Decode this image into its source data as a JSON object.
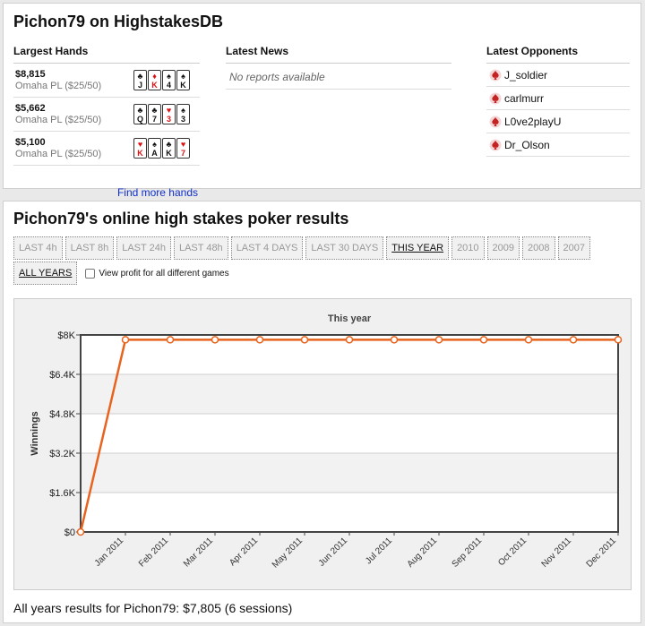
{
  "top": {
    "title": "Pichon79 on HighstakesDB",
    "largest_hands": {
      "heading": "Largest Hands",
      "hands": [
        {
          "amount": "$8,815",
          "game": "Omaha PL ($25/50)",
          "cards": [
            {
              "rank": "J",
              "suit": "♣",
              "color": "black"
            },
            {
              "rank": "K",
              "suit": "♦",
              "color": "red"
            },
            {
              "rank": "4",
              "suit": "♠",
              "color": "black"
            },
            {
              "rank": "K",
              "suit": "♠",
              "color": "black"
            }
          ]
        },
        {
          "amount": "$5,662",
          "game": "Omaha PL ($25/50)",
          "cards": [
            {
              "rank": "Q",
              "suit": "♣",
              "color": "black"
            },
            {
              "rank": "7",
              "suit": "♣",
              "color": "black"
            },
            {
              "rank": "3",
              "suit": "♥",
              "color": "red"
            },
            {
              "rank": "3",
              "suit": "♠",
              "color": "black"
            }
          ]
        },
        {
          "amount": "$5,100",
          "game": "Omaha PL ($25/50)",
          "cards": [
            {
              "rank": "K",
              "suit": "♥",
              "color": "red"
            },
            {
              "rank": "A",
              "suit": "♠",
              "color": "black"
            },
            {
              "rank": "K",
              "suit": "♣",
              "color": "black"
            },
            {
              "rank": "7",
              "suit": "♥",
              "color": "red"
            }
          ]
        }
      ],
      "find_more": "Find more hands"
    },
    "news": {
      "heading": "Latest News",
      "empty": "No reports available"
    },
    "opponents": {
      "heading": "Latest Opponents",
      "names": [
        "J_soldier",
        "carlmurr",
        "L0ve2playU",
        "Dr_Olson"
      ]
    }
  },
  "results": {
    "title": "Pichon79's online high stakes poker results",
    "tabs": [
      {
        "label": "LAST 4h",
        "active": false
      },
      {
        "label": "LAST 8h",
        "active": false
      },
      {
        "label": "LAST 24h",
        "active": false
      },
      {
        "label": "LAST 48h",
        "active": false
      },
      {
        "label": "LAST 4 DAYS",
        "active": false
      },
      {
        "label": "LAST 30 DAYS",
        "active": false
      },
      {
        "label": "THIS YEAR",
        "active": true
      },
      {
        "label": "2010",
        "active": false
      },
      {
        "label": "2009",
        "active": false
      },
      {
        "label": "2008",
        "active": false
      },
      {
        "label": "2007",
        "active": false
      }
    ],
    "tab_all_years": "ALL YEARS",
    "checkbox_label": "View profit for all different games",
    "summary": "All years results for Pichon79: $7,805 (6 sessions)"
  },
  "chart_data": {
    "type": "line",
    "title": "This year",
    "ylabel": "Winnings",
    "xlabel": "",
    "ylim": [
      0,
      8000
    ],
    "yticks": [
      0,
      1600,
      3200,
      4800,
      6400,
      8000
    ],
    "ytick_labels": [
      "$0",
      "$1.6K",
      "$3.2K",
      "$4.8K",
      "$6.4K",
      "$8K"
    ],
    "x": [
      "",
      "Jan 2011",
      "Feb 2011",
      "Mar 2011",
      "Apr 2011",
      "May 2011",
      "Jun 2011",
      "Jul 2011",
      "Aug 2011",
      "Sep 2011",
      "Oct 2011",
      "Nov 2011",
      "Dec 2011"
    ],
    "series": [
      {
        "values": [
          0,
          7805,
          7805,
          7805,
          7805,
          7805,
          7805,
          7805,
          7805,
          7805,
          7805,
          7805,
          7805
        ],
        "color": "#e8641e"
      }
    ],
    "grid": true
  }
}
